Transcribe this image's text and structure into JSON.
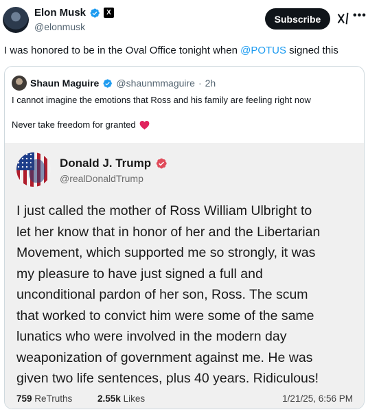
{
  "author": {
    "name": "Elon Musk",
    "handle": "@elonmusk",
    "x_badge": "X",
    "icons": [
      "verified-badge-icon",
      "x-affiliate-icon",
      "grok-icon",
      "more-icon"
    ]
  },
  "header": {
    "subscribe_label": "Subscribe",
    "more_label": "•••"
  },
  "tweet": {
    "text_before": "I was honored to be in the Oval Office tonight when ",
    "mention": "@POTUS",
    "text_after": " signed this"
  },
  "quote": {
    "name": "Shaun Maguire",
    "handle": "@shaunmmaguire",
    "separator": "·",
    "time": "2h",
    "line1": "I cannot imagine the emotions that Ross and his family are feeling right now",
    "line2": "Never take freedom for granted",
    "heart_color": "#e0245e"
  },
  "truth": {
    "name": "Donald J. Trump",
    "handle": "@realDonaldTrump",
    "verified_color": "#e04b5a",
    "body_lines": [
      "I just called the mother of Ross William Ulbright to",
      "let her know that in honor of her and the Libertarian",
      "Movement, which supported me so strongly, it was",
      "my pleasure to have just signed a full and",
      "unconditional pardon of her son, Ross. The scum",
      "that worked to convict him were some of the same",
      "lunatics who were involved in the modern day",
      "weaponization of government against me. He was",
      "given two life sentences, plus 40 years. Ridiculous!"
    ],
    "retruths_count": "759",
    "retruths_label": "ReTruths",
    "likes_count": "2.55k",
    "likes_label": "Likes",
    "date": "1/21/25, 6:56 PM"
  },
  "colors": {
    "link": "#1d9bf0",
    "x_verified": "#1d9bf0",
    "truth_bg": "#f0f0f0"
  }
}
